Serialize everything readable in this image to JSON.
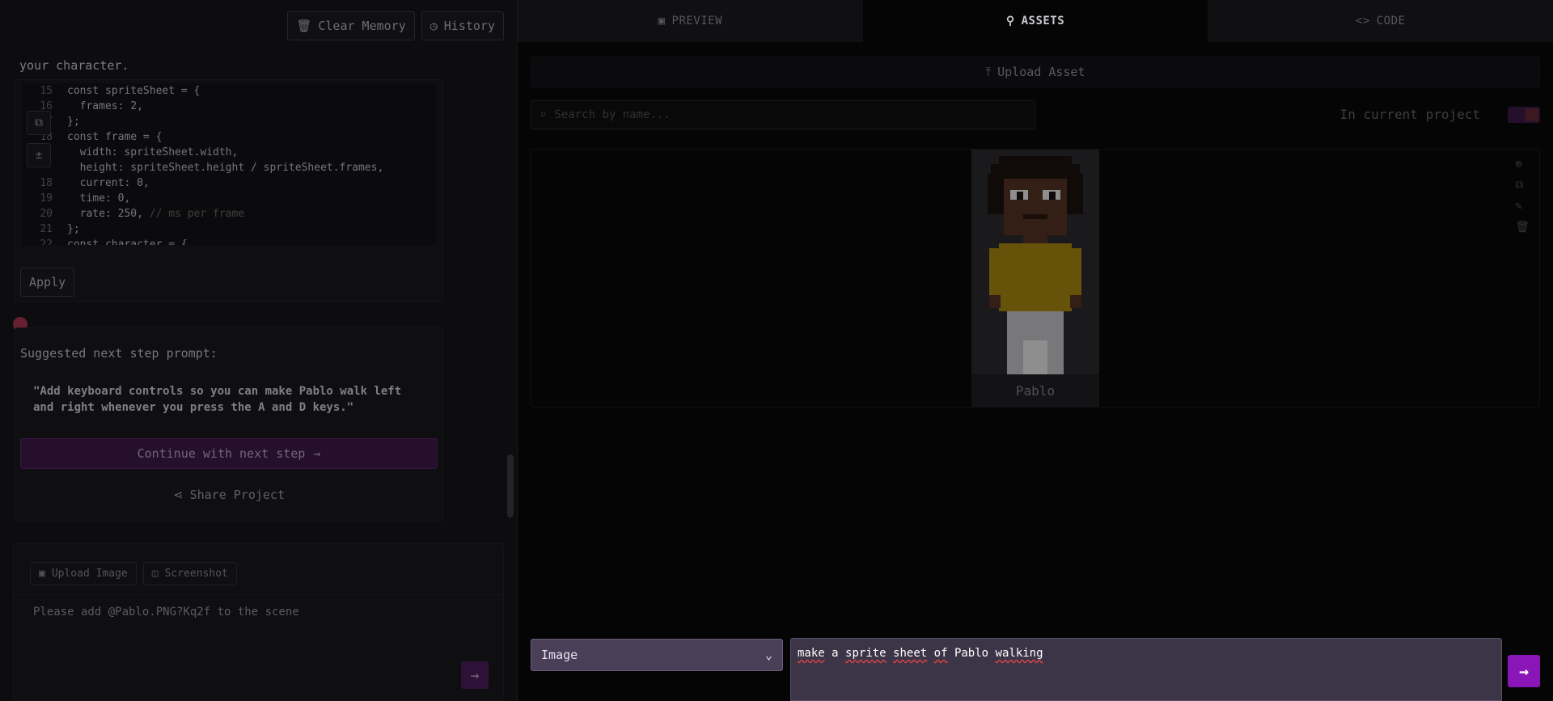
{
  "left": {
    "top_actions": {
      "clear_memory": "Clear Memory",
      "history": "History"
    },
    "message_tail": "your character.",
    "code_lines": [
      {
        "n": "15",
        "t": "const spriteSheet = {",
        "c": ""
      },
      {
        "n": "16",
        "t": "  frames: 2,",
        "c": ""
      },
      {
        "n": "17",
        "t": "};",
        "c": ""
      },
      {
        "n": "18",
        "t": "const frame = {",
        "c": ""
      },
      {
        "n": "",
        "t": "  width: spriteSheet.width,",
        "c": ""
      },
      {
        "n": "",
        "t": "  height: spriteSheet.height / spriteSheet.frames,",
        "c": ""
      },
      {
        "n": "18",
        "t": "  current: 0,",
        "c": ""
      },
      {
        "n": "19",
        "t": "  time: 0,",
        "c": ""
      },
      {
        "n": "20",
        "t": "  rate: 250, ",
        "c": "// ms per frame"
      },
      {
        "n": "21",
        "t": "};",
        "c": ""
      },
      {
        "n": "22",
        "t": "const character = {",
        "c": ""
      }
    ],
    "apply": "Apply",
    "suggest_label": "Suggested next step prompt:",
    "suggest_quote": "\"Add keyboard controls so you can make Pablo walk left and right whenever you press the A and D keys.\"",
    "continue": "Continue with next step",
    "share": "Share Project",
    "input": {
      "upload_image": "Upload Image",
      "screenshot": "Screenshot",
      "text": "Please add @Pablo.PNG?Kq2f to the scene"
    }
  },
  "right": {
    "tabs": [
      {
        "label": "PREVIEW",
        "icon": "image-icon"
      },
      {
        "label": "ASSETS",
        "icon": "assets-icon"
      },
      {
        "label": "CODE",
        "icon": "code-icon"
      }
    ],
    "upload_asset": "Upload Asset",
    "search_placeholder": "Search by name...",
    "in_current_project": "In current project",
    "asset": {
      "name": "Pablo"
    },
    "generate": {
      "type": "Image",
      "prompt_words": [
        "make",
        "a",
        "sprite",
        "sheet",
        "of",
        "Pablo",
        "walking"
      ]
    }
  }
}
